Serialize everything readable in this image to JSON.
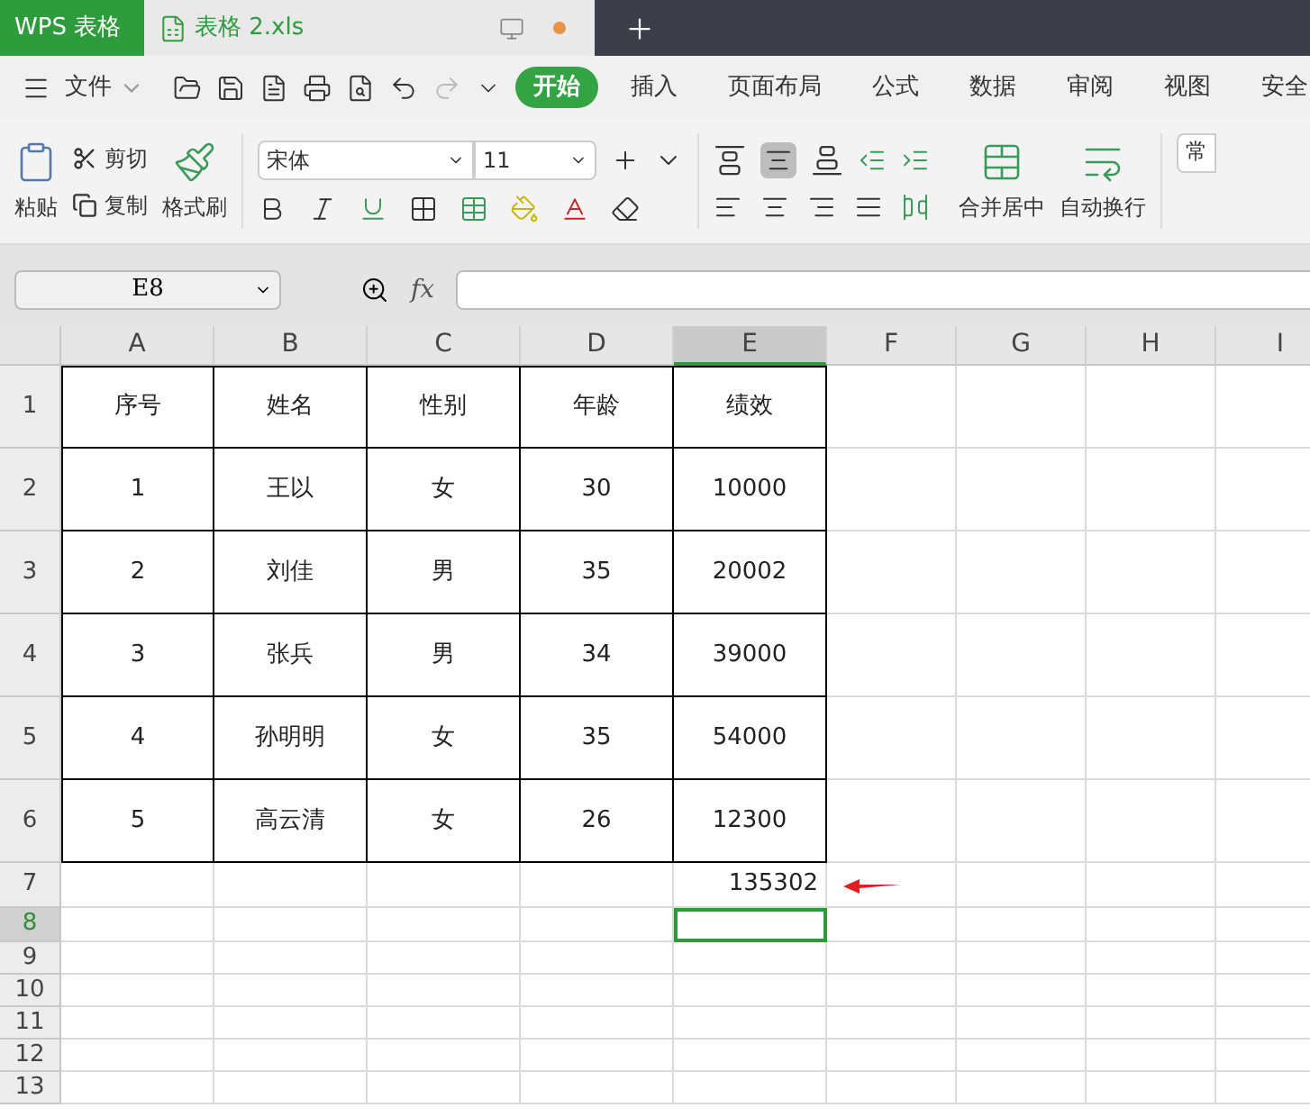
{
  "title_bar": {
    "app_tab": "WPS 表格",
    "doc_tab": "表格 2.xls",
    "unsaved": true
  },
  "menu": {
    "file": "文件",
    "tabs": [
      {
        "label": "开始",
        "selected": true
      },
      {
        "label": "插入",
        "selected": false
      },
      {
        "label": "页面布局",
        "selected": false
      },
      {
        "label": "公式",
        "selected": false
      },
      {
        "label": "数据",
        "selected": false
      },
      {
        "label": "审阅",
        "selected": false
      },
      {
        "label": "视图",
        "selected": false
      },
      {
        "label": "安全",
        "selected": false
      }
    ]
  },
  "ribbon": {
    "paste": "粘贴",
    "cut": "剪切",
    "copy": "复制",
    "format_painter": "格式刷",
    "font": "宋体",
    "font_size": "11",
    "center_align_selected": true,
    "merge": "合并居中",
    "wrap": "自动换行",
    "cut_off": "常"
  },
  "formula_bar": {
    "name_box": "E8",
    "fx": "fx"
  },
  "columns": [
    {
      "label": "A",
      "selected": false
    },
    {
      "label": "B",
      "selected": false
    },
    {
      "label": "C",
      "selected": false
    },
    {
      "label": "D",
      "selected": false
    },
    {
      "label": "E",
      "selected": true
    },
    {
      "label": "F",
      "selected": false
    },
    {
      "label": "G",
      "selected": false
    },
    {
      "label": "H",
      "selected": false
    },
    {
      "label": "I",
      "selected": false
    }
  ],
  "rows": [
    {
      "label": "1",
      "kind": "table",
      "selected": false,
      "cells": [
        "序号",
        "姓名",
        "性别",
        "年龄",
        "绩效"
      ]
    },
    {
      "label": "2",
      "kind": "table",
      "selected": false,
      "cells": [
        "1",
        "王以",
        "女",
        "30",
        "10000"
      ]
    },
    {
      "label": "3",
      "kind": "table",
      "selected": false,
      "cells": [
        "2",
        "刘佳",
        "男",
        "35",
        "20002"
      ]
    },
    {
      "label": "4",
      "kind": "table",
      "selected": false,
      "cells": [
        "3",
        "张兵",
        "男",
        "34",
        "39000"
      ]
    },
    {
      "label": "5",
      "kind": "table",
      "selected": false,
      "cells": [
        "4",
        "孙明明",
        "女",
        "35",
        "54000"
      ]
    },
    {
      "label": "6",
      "kind": "table",
      "selected": false,
      "cells": [
        "5",
        "高云清",
        "女",
        "26",
        "12300"
      ]
    },
    {
      "label": "7",
      "kind": "total",
      "selected": false,
      "total": "135302"
    },
    {
      "label": "8",
      "kind": "empty",
      "selected": true
    },
    {
      "label": "9",
      "kind": "empty",
      "selected": false
    },
    {
      "label": "10",
      "kind": "empty",
      "selected": false
    },
    {
      "label": "11",
      "kind": "empty",
      "selected": false
    },
    {
      "label": "12",
      "kind": "empty",
      "selected": false
    },
    {
      "label": "13",
      "kind": "empty",
      "selected": false
    }
  ]
}
